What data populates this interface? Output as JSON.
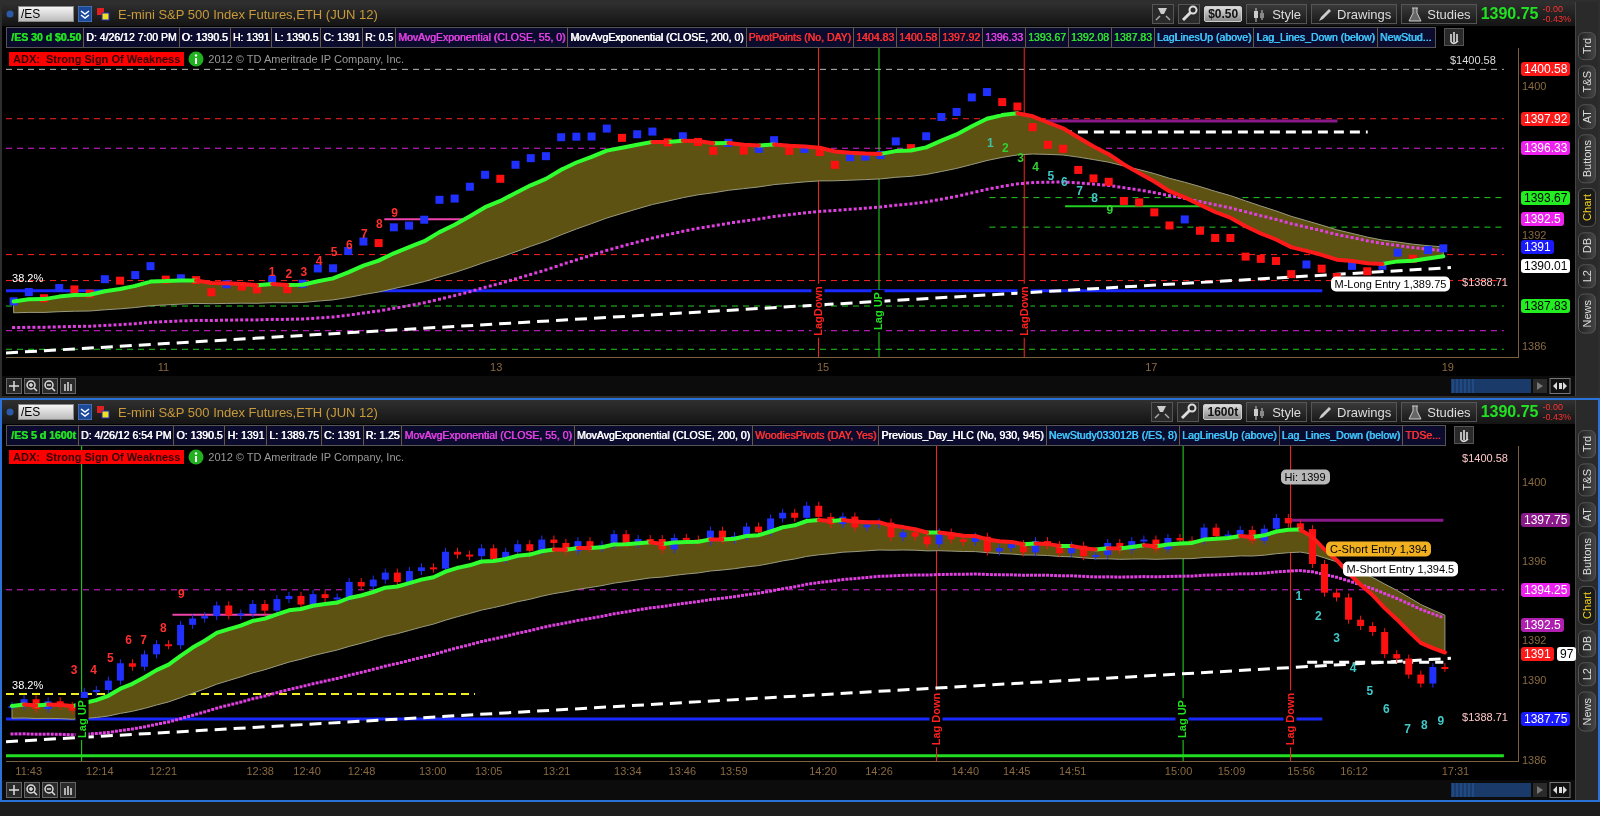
{
  "panes": [
    {
      "selected": false,
      "symbol": "/ES",
      "title": "E-mini S&P 500 Index Futures,ETH (JUN 12)",
      "aggregation": "$0.50",
      "toolbar": [
        "Style",
        "Drawings",
        "Studies"
      ],
      "last": "1390.75",
      "change": "-0.00",
      "change_percent": "-0.43%",
      "studies": [
        {
          "text": "/ES 30 d $0.50",
          "color": "#22dd22"
        },
        {
          "text": "D: 4/26/12 7:00 PM",
          "color": "#ffffff"
        },
        {
          "text": "O: 1390.5",
          "color": "#ffffff"
        },
        {
          "text": "H: 1391",
          "color": "#ffffff"
        },
        {
          "text": "L: 1390.5",
          "color": "#ffffff"
        },
        {
          "text": "C: 1391",
          "color": "#ffffff"
        },
        {
          "text": "R: 0.5",
          "color": "#ffffff"
        },
        {
          "text": "MovAvgExponential (CLOSE, 55, 0)",
          "color": "#e040e0"
        },
        {
          "text": "MovAvgExponential (CLOSE, 200, 0)",
          "color": "#ffffff"
        },
        {
          "text": "PivotPoints (No, DAY)",
          "color": "#ff3030"
        },
        {
          "text": "1404.83",
          "color": "#ff3030"
        },
        {
          "text": "1400.58",
          "color": "#ff3030"
        },
        {
          "text": "1397.92",
          "color": "#ff3030"
        },
        {
          "text": "1396.33",
          "color": "#e040e0"
        },
        {
          "text": "1393.67",
          "color": "#30e030"
        },
        {
          "text": "1392.08",
          "color": "#30e030"
        },
        {
          "text": "1387.83",
          "color": "#30e030"
        },
        {
          "text": "LagLinesUp (above)",
          "color": "#40c8ff"
        },
        {
          "text": "Lag_Lines_Down (below)",
          "color": "#40c8ff"
        },
        {
          "text": "NewStud...",
          "color": "#40c8ff"
        }
      ],
      "alert": "ADX:  Strong Sign Of Weakness",
      "copyright": "2012 © TD Ameritrade IP Company, Inc.",
      "y_ticks": [
        "1400",
        "1392",
        "1386"
      ],
      "price_tags": [
        {
          "text": "1400.58",
          "color": "#ff1a1a"
        },
        {
          "text": "1397.92",
          "color": "#ff1a1a"
        },
        {
          "text": "1396.33",
          "color": "#ee22ee"
        },
        {
          "text": "1393.67",
          "color": "#22ee22"
        },
        {
          "text": "1392.5",
          "color": "#ee22ee"
        },
        {
          "text": "1391",
          "color": "#1a1aff"
        },
        {
          "text": "1390.01",
          "color": "#ffffff"
        },
        {
          "text": "1387.83",
          "color": "#22ee22"
        }
      ],
      "annotations": [
        {
          "kind": "note",
          "text": "$1400.58",
          "color": "#dddddd"
        },
        {
          "kind": "vertical_label",
          "text": "LagDown",
          "color": "#ff2020"
        },
        {
          "kind": "vertical_label",
          "text": "Lag UP",
          "color": "#20e020"
        },
        {
          "kind": "vertical_label",
          "text": "LagDown",
          "color": "#ff2020"
        },
        {
          "kind": "count",
          "text": "1",
          "color": "#ff3030"
        },
        {
          "kind": "count",
          "text": "2",
          "color": "#ff3030"
        },
        {
          "kind": "count",
          "text": "3",
          "color": "#ff3030"
        },
        {
          "kind": "count",
          "text": "4",
          "color": "#ff3030"
        },
        {
          "kind": "count",
          "text": "5",
          "color": "#ff3030"
        },
        {
          "kind": "count",
          "text": "6",
          "color": "#ff3030"
        },
        {
          "kind": "count",
          "text": "7",
          "color": "#ff3030"
        },
        {
          "kind": "count",
          "text": "8",
          "color": "#ff3030"
        },
        {
          "kind": "count",
          "text": "9",
          "color": "#ff3030"
        },
        {
          "kind": "count",
          "text": "1",
          "color": "#40c0a0"
        },
        {
          "kind": "count",
          "text": "2",
          "color": "#30d030"
        },
        {
          "kind": "count",
          "text": "3",
          "color": "#30d030"
        },
        {
          "kind": "count",
          "text": "4",
          "color": "#30d030"
        },
        {
          "kind": "count",
          "text": "5",
          "color": "#40c8c8"
        },
        {
          "kind": "count",
          "text": "6",
          "color": "#40c8c8"
        },
        {
          "kind": "count",
          "text": "7",
          "color": "#40c8c8"
        },
        {
          "kind": "count",
          "text": "8",
          "color": "#40c8c8"
        },
        {
          "kind": "count",
          "text": "9",
          "color": "#30d030"
        },
        {
          "kind": "note",
          "text": "38.2%",
          "color": "#ffffff"
        },
        {
          "kind": "callout",
          "text": "M-Long Entry 1,389.75",
          "color": "#ffffff"
        },
        {
          "kind": "note",
          "text": "$1388.71",
          "color": "#ffc8c8"
        }
      ],
      "x_labels": [
        "11",
        "13",
        "15",
        "17",
        "19"
      ],
      "side_tabs": [
        {
          "label": "Trd",
          "selected": false
        },
        {
          "label": "T&S",
          "selected": false
        },
        {
          "label": "AT",
          "selected": false
        },
        {
          "label": "Buttons",
          "selected": false
        },
        {
          "label": "Chart",
          "selected": true
        },
        {
          "label": "DB",
          "selected": false
        },
        {
          "label": "L2",
          "selected": false
        },
        {
          "label": "News",
          "selected": false
        }
      ]
    },
    {
      "selected": true,
      "symbol": "/ES",
      "title": "E-mini S&P 500 Index Futures,ETH (JUN 12)",
      "aggregation": "1600t",
      "toolbar": [
        "Style",
        "Drawings",
        "Studies"
      ],
      "last": "1390.75",
      "change": "-0.00",
      "change_percent": "-0.43%",
      "studies": [
        {
          "text": "/ES 5 d 1600t",
          "color": "#22dd22"
        },
        {
          "text": "D: 4/26/12 6:54 PM",
          "color": "#ffffff"
        },
        {
          "text": "O: 1390.5",
          "color": "#ffffff"
        },
        {
          "text": "H: 1391",
          "color": "#ffffff"
        },
        {
          "text": "L: 1389.75",
          "color": "#ffffff"
        },
        {
          "text": "C: 1391",
          "color": "#ffffff"
        },
        {
          "text": "R: 1.25",
          "color": "#ffffff"
        },
        {
          "text": "MovAvgExponential (CLOSE, 55, 0)",
          "color": "#e040e0"
        },
        {
          "text": "MovAvgExponential (CLOSE, 200, 0)",
          "color": "#ffffff"
        },
        {
          "text": "WoodiesPivots (DAY, Yes)",
          "color": "#ff3030"
        },
        {
          "text": "Previous_Day_HLC (No, 930, 945)",
          "color": "#ffffff"
        },
        {
          "text": "NewStudy033012B (/ES, 8)",
          "color": "#40c8ff"
        },
        {
          "text": "LagLinesUp (above)",
          "color": "#40c8ff"
        },
        {
          "text": "Lag_Lines_Down (below)",
          "color": "#40c8ff"
        },
        {
          "text": "TDSe...",
          "color": "#ff3030"
        }
      ],
      "alert": "ADX:  Strong Sign Of Weakness",
      "copyright": "2012 © TD Ameritrade IP Company, Inc.",
      "y_ticks": [
        "1400",
        "1396",
        "1392",
        "1390",
        "1386"
      ],
      "price_tags": [
        {
          "text": "1397.75",
          "color": "#8a1a8a"
        },
        {
          "text": "1394.25",
          "color": "#ee22ee"
        },
        {
          "text": "1392.5",
          "color": "#b020b0"
        },
        {
          "text": "1391",
          "color": "#ff1a1a"
        },
        {
          "text": "97",
          "color": "#ffffff"
        },
        {
          "text": "1387.75",
          "color": "#1a1aff"
        }
      ],
      "annotations": [
        {
          "kind": "note",
          "text": "$1400.58",
          "color": "#ffc8c8"
        },
        {
          "kind": "callout",
          "text": "Hi: 1399",
          "color": "#b8b8b8"
        },
        {
          "kind": "vertical_label",
          "text": "Lag UP",
          "color": "#20e020"
        },
        {
          "kind": "vertical_label",
          "text": "Lag Down",
          "color": "#ff2020"
        },
        {
          "kind": "vertical_label",
          "text": "Lag UP",
          "color": "#20e020"
        },
        {
          "kind": "vertical_label",
          "text": "Lag Down",
          "color": "#ff2020"
        },
        {
          "kind": "count",
          "text": "3",
          "color": "#ff3030"
        },
        {
          "kind": "count",
          "text": "4",
          "color": "#ff3030"
        },
        {
          "kind": "count",
          "text": "5",
          "color": "#ff3030"
        },
        {
          "kind": "count",
          "text": "6",
          "color": "#ff3030"
        },
        {
          "kind": "count",
          "text": "7",
          "color": "#ff3030"
        },
        {
          "kind": "count",
          "text": "8",
          "color": "#ff3030"
        },
        {
          "kind": "count",
          "text": "9",
          "color": "#ff3030"
        },
        {
          "kind": "callout",
          "text": "C-Short Entry 1,394",
          "color": "#f0b020"
        },
        {
          "kind": "callout",
          "text": "M-Short Entry 1,394.5",
          "color": "#ffffff"
        },
        {
          "kind": "count",
          "text": "1",
          "color": "#40c8c8"
        },
        {
          "kind": "count",
          "text": "2",
          "color": "#40c8c8"
        },
        {
          "kind": "count",
          "text": "3",
          "color": "#40c8c8"
        },
        {
          "kind": "count",
          "text": "4",
          "color": "#40c8c8"
        },
        {
          "kind": "count",
          "text": "5",
          "color": "#40c8c8"
        },
        {
          "kind": "count",
          "text": "6",
          "color": "#40c8c8"
        },
        {
          "kind": "count",
          "text": "7",
          "color": "#40c8c8"
        },
        {
          "kind": "count",
          "text": "8",
          "color": "#40c8c8"
        },
        {
          "kind": "count",
          "text": "9",
          "color": "#40c8c8"
        },
        {
          "kind": "note",
          "text": "38.2%",
          "color": "#ffffff"
        },
        {
          "kind": "note",
          "text": "$1388.71",
          "color": "#ffc8c8"
        }
      ],
      "x_labels": [
        "11:43",
        "12:14",
        "12:21",
        "12:38",
        "12:40",
        "12:48",
        "13:00",
        "13:05",
        "13:21",
        "13:34",
        "13:46",
        "13:59",
        "14:20",
        "14:26",
        "14:40",
        "14:45",
        "14:51",
        "15:00",
        "15:09",
        "15:56",
        "16:12",
        "17:31"
      ],
      "side_tabs": [
        {
          "label": "Trd",
          "selected": false
        },
        {
          "label": "T&S",
          "selected": false
        },
        {
          "label": "AT",
          "selected": false
        },
        {
          "label": "Buttons",
          "selected": false
        },
        {
          "label": "Chart",
          "selected": true
        },
        {
          "label": "DB",
          "selected": false
        },
        {
          "label": "L2",
          "selected": false
        },
        {
          "label": "News",
          "selected": false
        }
      ]
    }
  ]
}
